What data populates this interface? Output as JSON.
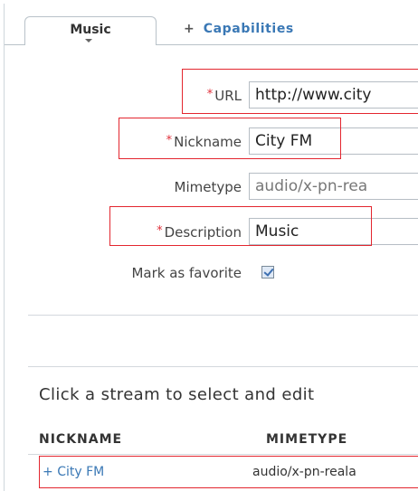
{
  "tabs": {
    "music_label": "Music",
    "capabilities_prefix": "+",
    "capabilities_label": "Capabilities"
  },
  "form": {
    "required_marker": "*",
    "url_label": "URL",
    "url_value": "http://www.city",
    "nickname_label": "Nickname",
    "nickname_value": "City FM",
    "mimetype_label": "Mimetype",
    "mimetype_value": "audio/x-pn-rea",
    "description_label": "Description",
    "description_value": "Music",
    "favorite_label": "Mark as favorite",
    "favorite_checked": true
  },
  "streams": {
    "title": "Click a stream to select and edit",
    "columns": [
      "NICKNAME",
      "MIMETYPE"
    ],
    "rows": [
      {
        "prefix": "+",
        "nickname": "City FM",
        "mimetype": "audio/x-pn-reala"
      }
    ]
  },
  "colors": {
    "link": "#3a78b5",
    "required": "#e0303a",
    "highlight": "#e3262f"
  }
}
